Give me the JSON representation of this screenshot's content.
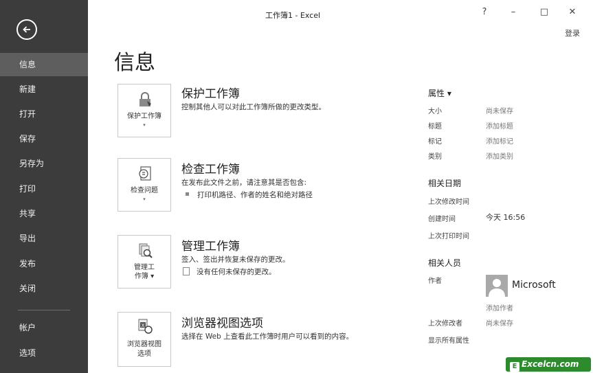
{
  "titlebar": {
    "title": "工作簿1 - Excel",
    "help": "?",
    "minimize": "–",
    "maximize": "□",
    "close": "✕",
    "login": "登录"
  },
  "sidebar": {
    "items": [
      {
        "label": "信息"
      },
      {
        "label": "新建"
      },
      {
        "label": "打开"
      },
      {
        "label": "保存"
      },
      {
        "label": "另存为"
      },
      {
        "label": "打印"
      },
      {
        "label": "共享"
      },
      {
        "label": "导出"
      },
      {
        "label": "发布"
      },
      {
        "label": "关闭"
      },
      {
        "label": "帐户"
      },
      {
        "label": "选项"
      }
    ]
  },
  "page": {
    "title": "信息"
  },
  "sections": [
    {
      "button": [
        "保护工作簿",
        ""
      ],
      "caret": "▾",
      "title": "保护工作簿",
      "desc": "控制其他人可以对此工作簿所做的更改类型。"
    },
    {
      "button": [
        "检查问题",
        ""
      ],
      "caret": "▾",
      "title": "检查工作簿",
      "desc": "在发布此文件之前，请注意其是否包含:",
      "bullet": "打印机路径、作者的姓名和绝对路径"
    },
    {
      "button": [
        "管理工",
        "作簿 ▾"
      ],
      "title": "管理工作簿",
      "desc": "签入、签出并恢复未保存的更改。",
      "bullet": "没有任何未保存的更改。"
    },
    {
      "button": [
        "浏览器视图",
        "选项"
      ],
      "title": "浏览器视图选项",
      "desc": "选择在 Web 上查看此工作簿时用户可以看到的内容。"
    }
  ],
  "properties": {
    "heading": "属性 ▾",
    "items": [
      {
        "label": "大小",
        "value": "尚未保存"
      },
      {
        "label": "标题",
        "value": "添加标题"
      },
      {
        "label": "标记",
        "value": "添加标记"
      },
      {
        "label": "类别",
        "value": "添加类别"
      }
    ]
  },
  "dates": {
    "heading": "相关日期",
    "items": [
      {
        "label": "上次修改时间",
        "value": ""
      },
      {
        "label": "创建时间",
        "value": "今天 16:56"
      },
      {
        "label": "上次打印时间",
        "value": ""
      }
    ]
  },
  "people": {
    "heading": "相关人员",
    "author_label": "作者",
    "author_name": "Microsoft",
    "add_author": "添加作者",
    "last_modified_label": "上次修改者",
    "last_modified_value": "尚未保存",
    "show_all": "显示所有属性"
  },
  "watermark": {
    "logo": "E",
    "text": "Excelcn.com"
  }
}
